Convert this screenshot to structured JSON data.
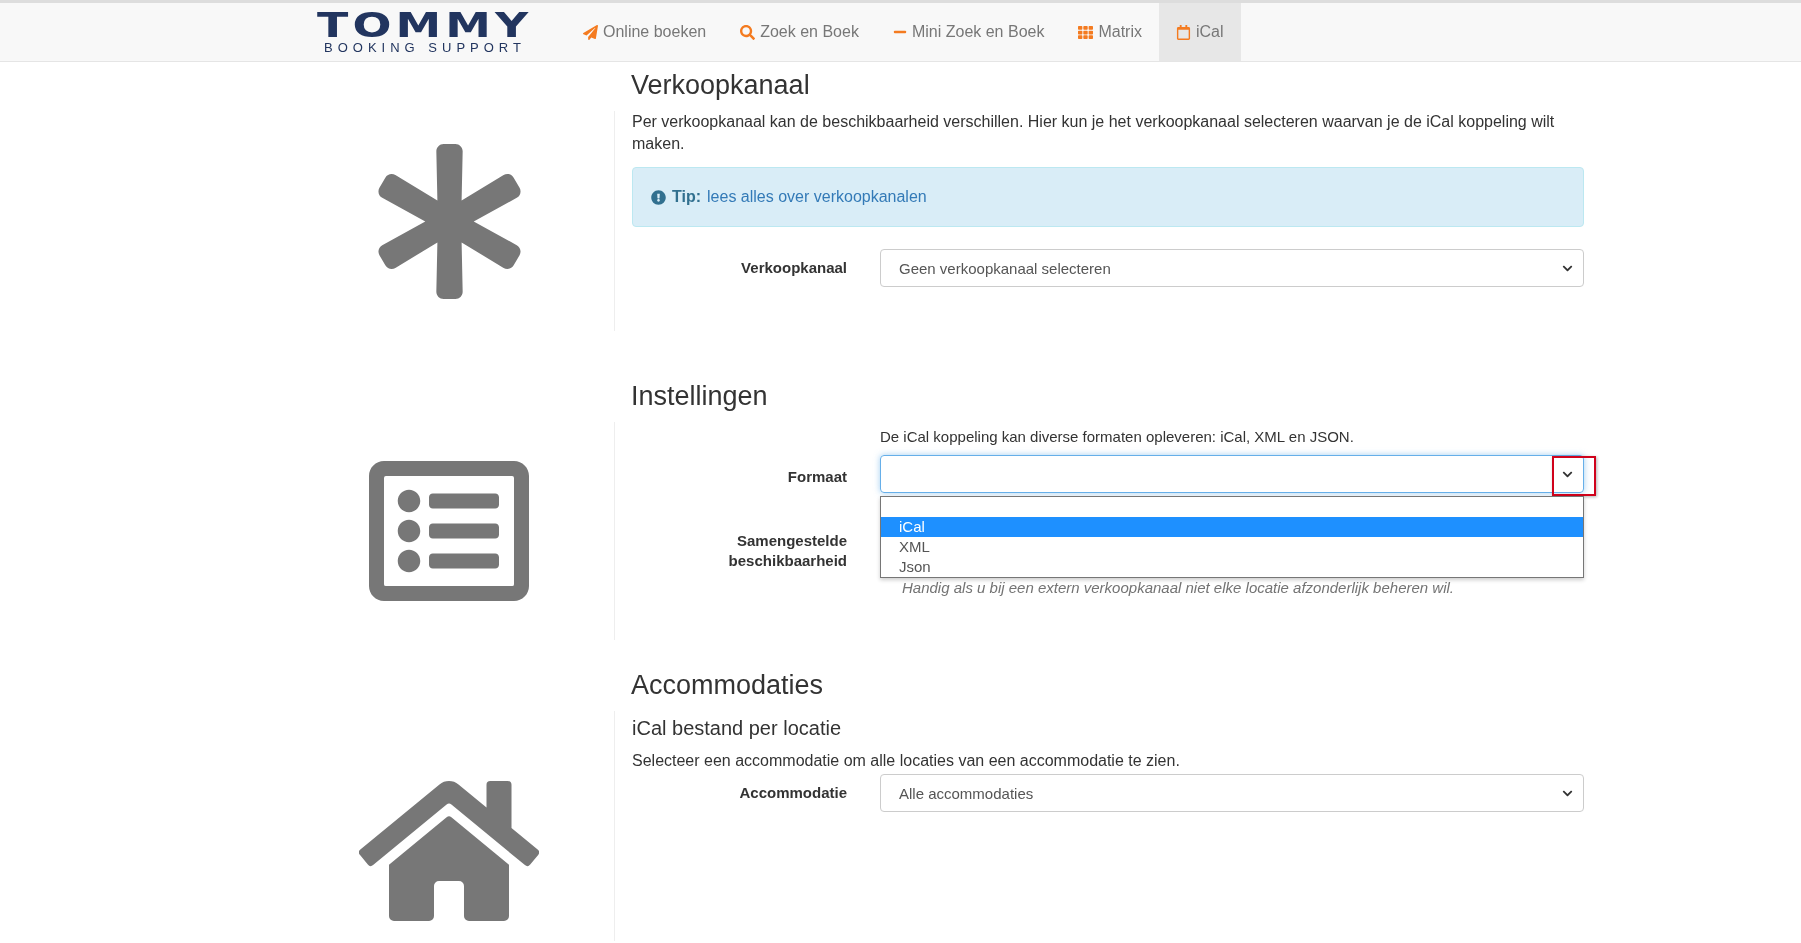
{
  "logo": {
    "title": "TOMMY",
    "subtitle": "BOOKING SUPPORT"
  },
  "nav": [
    {
      "label": "Online boeken",
      "selected": false
    },
    {
      "label": "Zoek en Boek",
      "selected": false
    },
    {
      "label": "Mini Zoek en Boek",
      "selected": false
    },
    {
      "label": "Matrix",
      "selected": false
    },
    {
      "label": "iCal",
      "selected": true
    }
  ],
  "sections": [
    {
      "title": "Verkoopkanaal",
      "intro": "Per verkoopkanaal kan de beschikbaarheid verschillen. Hier kun je het verkoopkanaal selecteren waarvan je de iCal koppeling wilt maken.",
      "tip": {
        "label": "Tip:",
        "link": "lees alles over verkoopkanalen"
      },
      "fields": [
        {
          "kind": "select",
          "label": "Verkoopkanaal",
          "value": "Geen verkoopkanaal selecteren"
        }
      ]
    },
    {
      "title": "Instellingen",
      "fields": [
        {
          "kind": "select",
          "label": "Formaat",
          "description": "De iCal koppeling kan diverse formaten opleveren: iCal, XML en JSON.",
          "expanded": true,
          "highlighted": true,
          "options": [
            {
              "label": "iCal",
              "selected": true
            },
            {
              "label": "XML",
              "selected": false
            },
            {
              "label": "Json",
              "selected": false
            }
          ]
        },
        {
          "kind": "note",
          "label": "Samengestelde beschikbaarheid",
          "help": "Handig als u bij een extern verkoopkanaal niet elke locatie afzonderlijk beheren wil."
        }
      ]
    },
    {
      "title": "Accommodaties",
      "subtitle": "iCal bestand per locatie",
      "intro": "Selecteer een accommodatie om alle locaties van een accommodatie te zien.",
      "fields": [
        {
          "kind": "select",
          "label": "Accommodatie",
          "value": "Alle accommodaties"
        }
      ]
    }
  ]
}
